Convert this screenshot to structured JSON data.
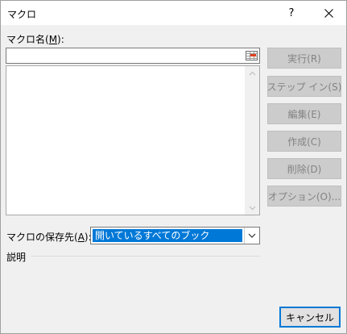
{
  "window": {
    "title": "マクロ",
    "help_symbol": "?",
    "close_icon": "close-icon"
  },
  "macro_name": {
    "label": "マクロ名(",
    "accel": "M",
    "label_end": "):",
    "value": "",
    "ref_icon": "range-select-icon"
  },
  "macro_list": {
    "items": []
  },
  "buttons": {
    "run": "実行(R)",
    "step_into": "ステップ イン(S)",
    "edit": "編集(E)",
    "create": "作成(C)",
    "delete": "削除(D)",
    "options": "オプション(O)...",
    "cancel": "キャンセル"
  },
  "store": {
    "label": "マクロの保存先(",
    "accel": "A",
    "label_end": "):",
    "selected": "開いているすべてのブック"
  },
  "description": {
    "label": "説明"
  },
  "colors": {
    "selection": "#0078d7",
    "disabled_button_bg": "#cccccc",
    "disabled_button_text": "#838383",
    "dialog_bg": "#f0f0f0"
  }
}
